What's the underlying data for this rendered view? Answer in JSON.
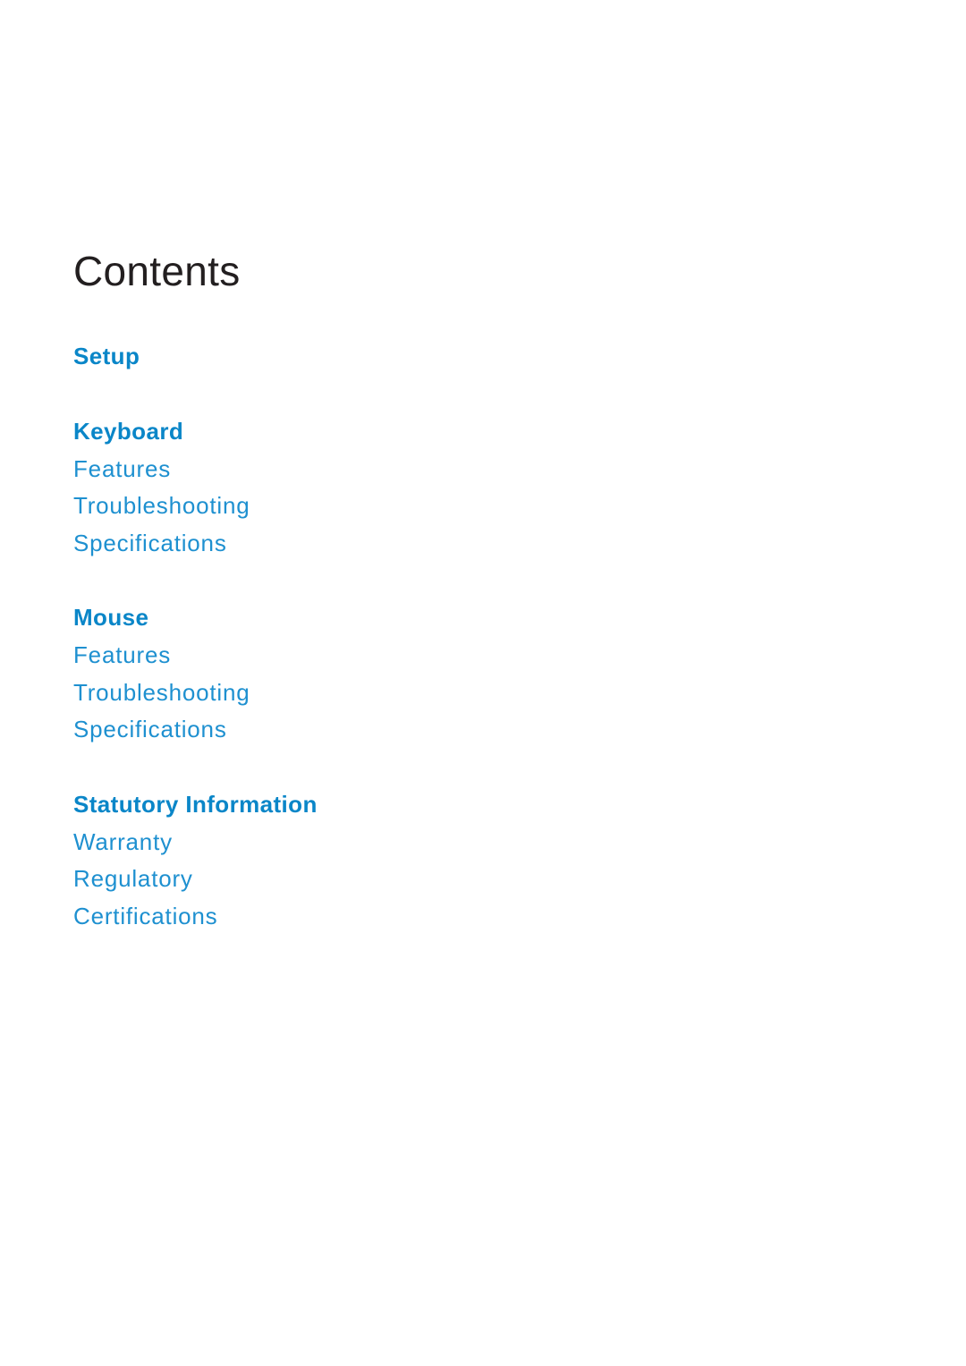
{
  "page": {
    "title": "Contents"
  },
  "toc": {
    "setup": {
      "label": "Setup"
    },
    "keyboard": {
      "label": "Keyboard",
      "items": [
        "Features",
        "Troubleshooting",
        "Specifications"
      ]
    },
    "mouse": {
      "label": "Mouse",
      "items": [
        "Features",
        "Troubleshooting",
        "Specifications"
      ]
    },
    "statutory": {
      "label": "Statutory Information",
      "items": [
        "Warranty",
        "Regulatory",
        "Certifications"
      ]
    }
  },
  "colors": {
    "title": "#231f20",
    "section": "#0a86c8",
    "item": "#1e90d0"
  }
}
